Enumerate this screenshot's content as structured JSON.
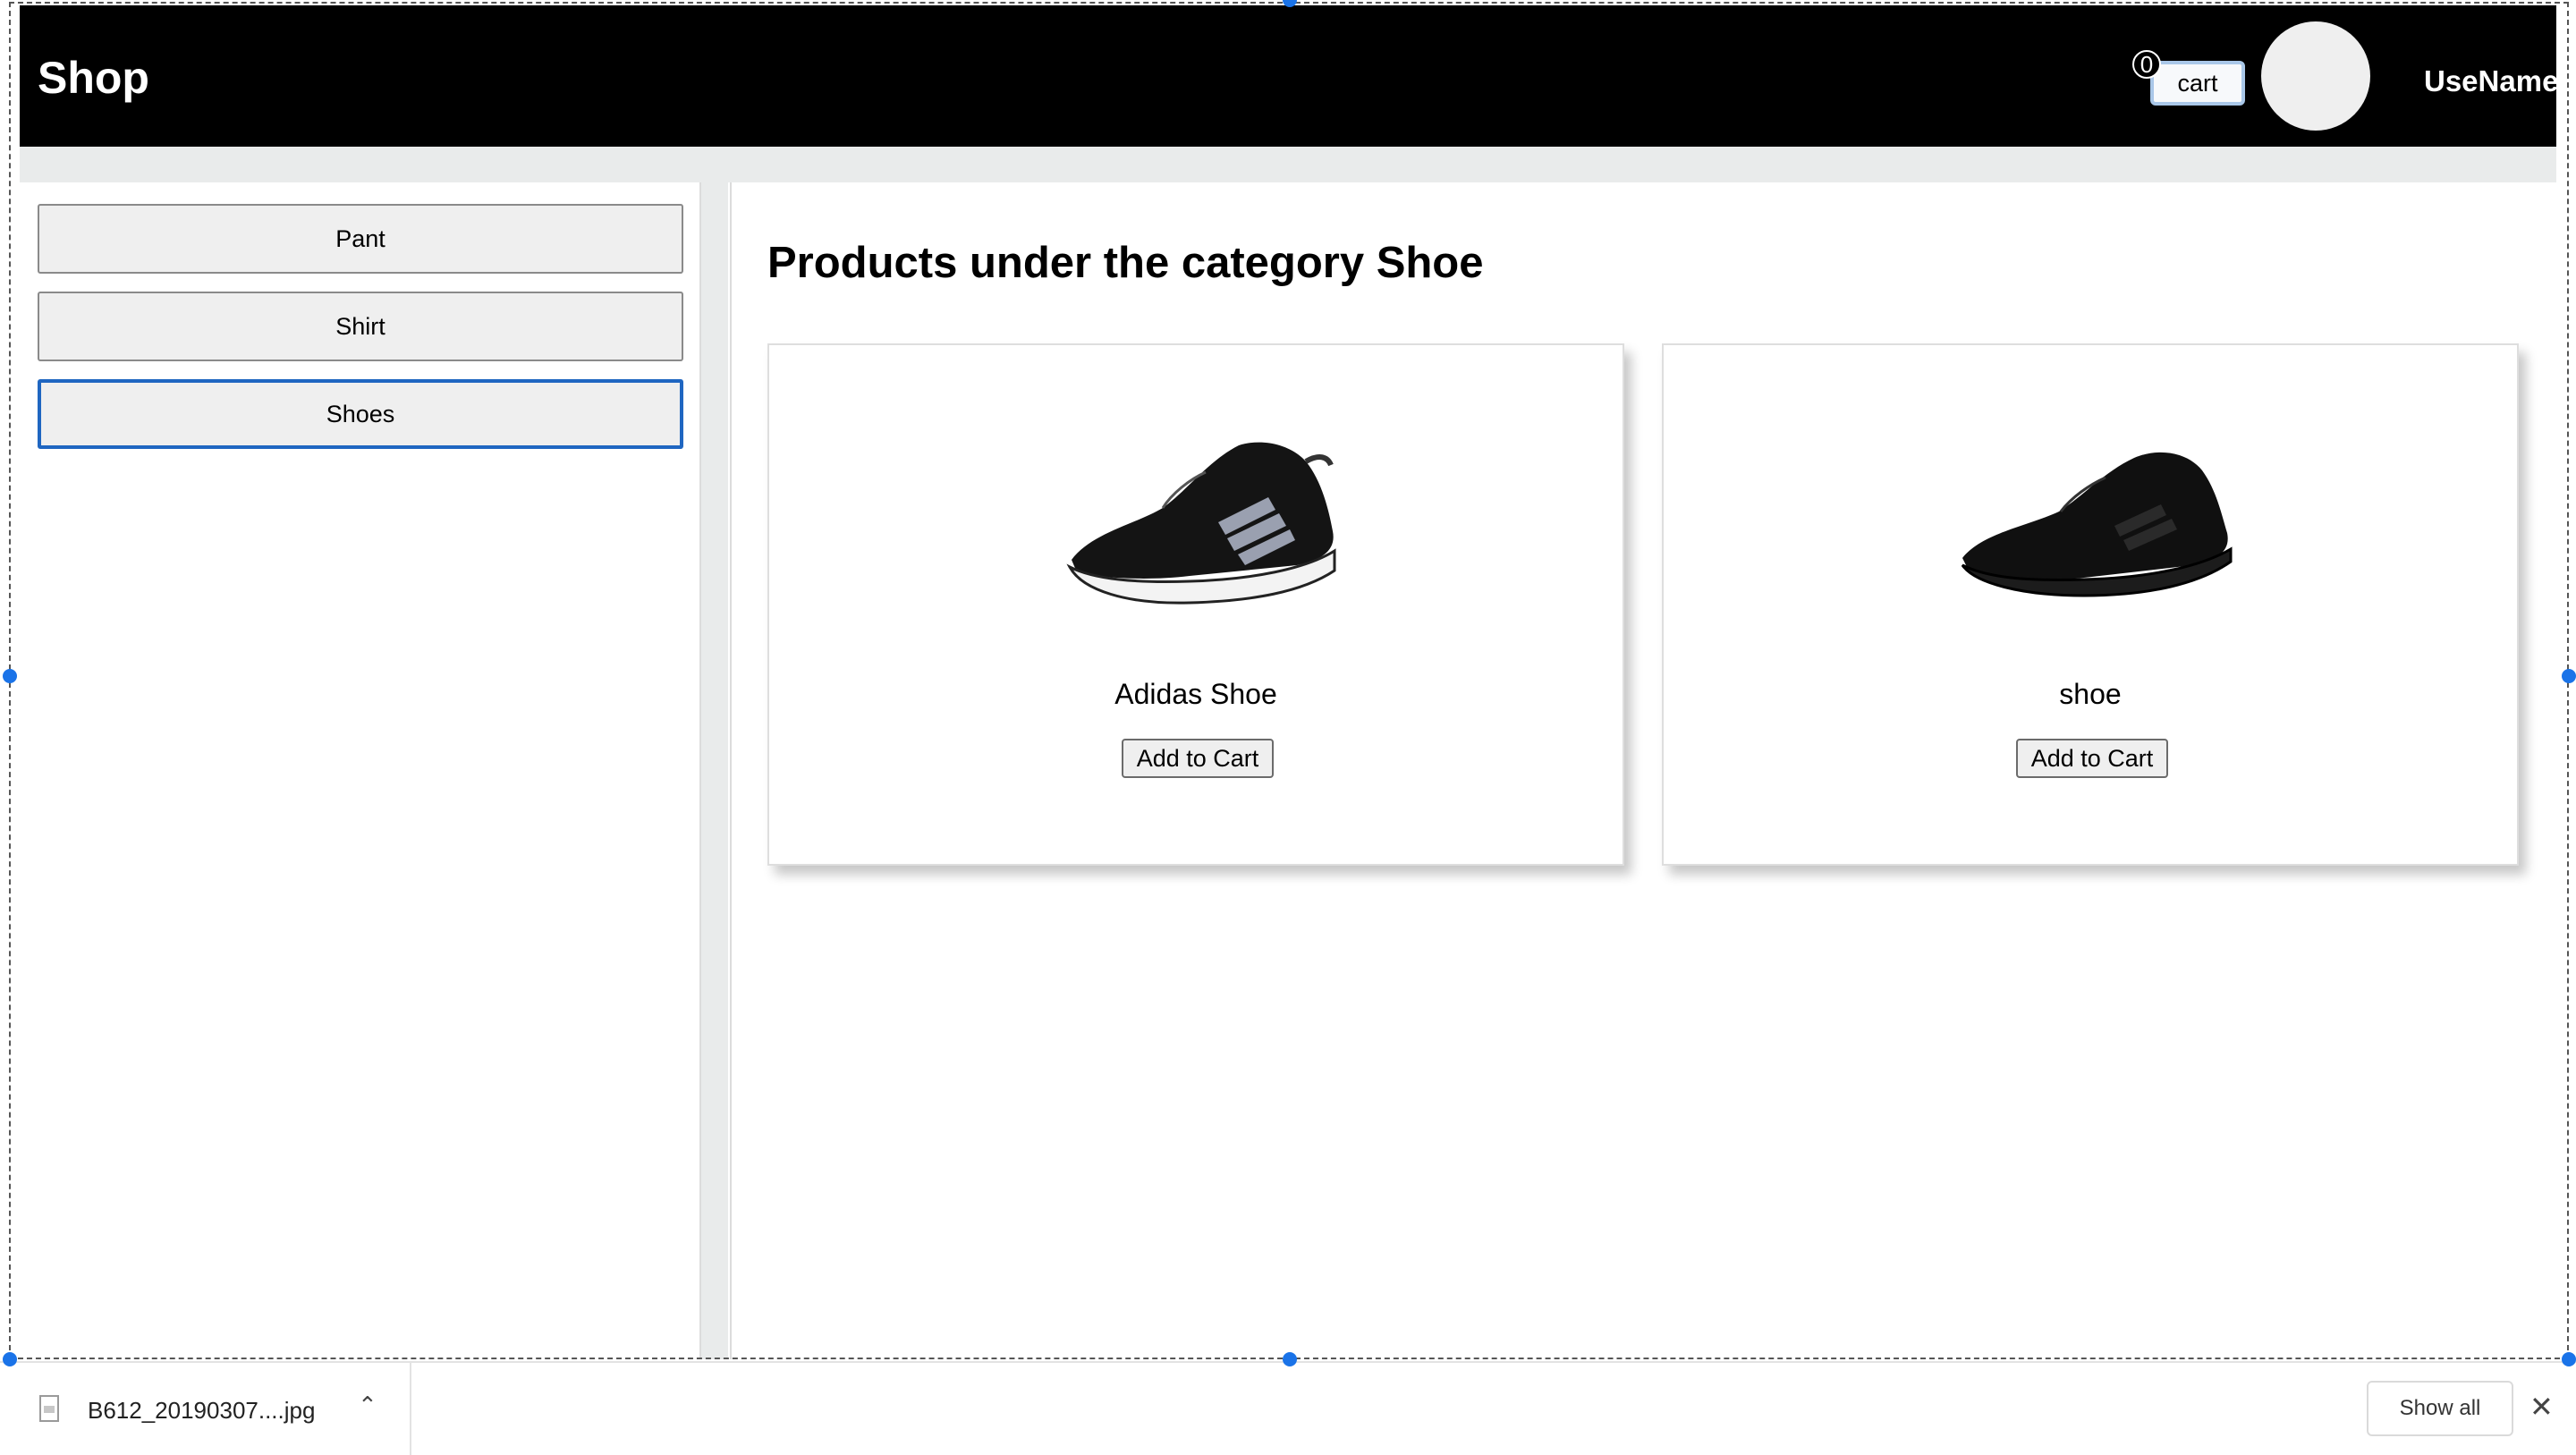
{
  "header": {
    "logo": "Shop",
    "cart_count": "0",
    "cart_label": "cart",
    "username": "UseName"
  },
  "sidebar": {
    "categories": [
      {
        "label": "Pant",
        "active": false
      },
      {
        "label": "Shirt",
        "active": false
      },
      {
        "label": "Shoes",
        "active": true
      }
    ]
  },
  "main": {
    "heading": "Products under the category Shoe",
    "products": [
      {
        "name": "Adidas Shoe",
        "button": "Add to Cart",
        "image": "black-running-shoe-with-white-sole"
      },
      {
        "name": "shoe",
        "button": "Add to Cart",
        "image": "all-black-running-shoe"
      }
    ]
  },
  "downloads_bar": {
    "file_name": "B612_20190307....jpg",
    "show_all_label": "Show all",
    "file_icon": "image-file-icon",
    "chevron_icon": "chevron-up-icon",
    "close_icon": "close-icon"
  },
  "colors": {
    "header_bg": "#000000",
    "active_border": "#1f66c1",
    "selection_handle": "#1a73e8"
  }
}
